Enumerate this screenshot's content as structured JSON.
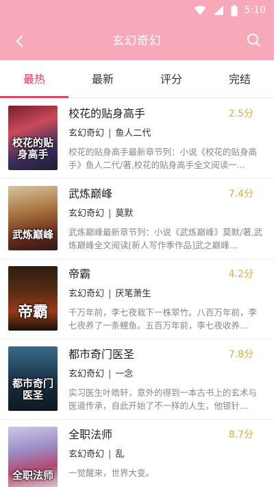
{
  "status_bar": {
    "time": "5:10"
  },
  "header": {
    "title": "玄幻奇幻"
  },
  "tabs": [
    {
      "label": "最热",
      "active": true
    },
    {
      "label": "最新",
      "active": false
    },
    {
      "label": "评分",
      "active": false
    },
    {
      "label": "完结",
      "active": false
    }
  ],
  "colors": {
    "header_bg": "#f7a9ba",
    "accent": "#e0435f",
    "score": "#e9a93a"
  },
  "books": [
    {
      "title": "校花的贴身高手",
      "score": "2.5分",
      "category": "玄幻奇幻",
      "author": "鱼人二代",
      "description": "校花的贴身高手最新章节列：小说《校花的贴身高手》鱼人二代/著,校花的贴身高手全文阅读一...",
      "cover_text": "校花的贴身高手"
    },
    {
      "title": "武炼巅峰",
      "score": "7.4分",
      "category": "玄幻奇幻",
      "author": "莫默",
      "description": "武炼巅峰最新章节列：小说《武炼巅峰》莫默/著,武炼巅峰全文阅读[新人写作季作品]武之巅峰...",
      "cover_text": "武炼巅峰"
    },
    {
      "title": "帝霸",
      "score": "4.2分",
      "category": "玄幻奇幻",
      "author": "厌笔萧生",
      "description": "千万年前，李七夜栽下一株翠竹。八百万年前，李七夜养了一条鲤鱼。五百万年前，李七夜收养...",
      "cover_text": "帝霸"
    },
    {
      "title": "都市奇门医圣",
      "score": "7.8分",
      "category": "玄幻奇幻",
      "author": "一念",
      "description": "实习医生叶皓轩，意外的得到一本古书上的玄术与医道传承，自此开始了不一样的人生，他银针...",
      "cover_text": "都市奇门医圣"
    },
    {
      "title": "全职法师",
      "score": "8.7分",
      "category": "玄幻奇幻",
      "author": "乱",
      "description": "一觉醒来，世界大变。",
      "cover_text": "全职法师"
    }
  ]
}
